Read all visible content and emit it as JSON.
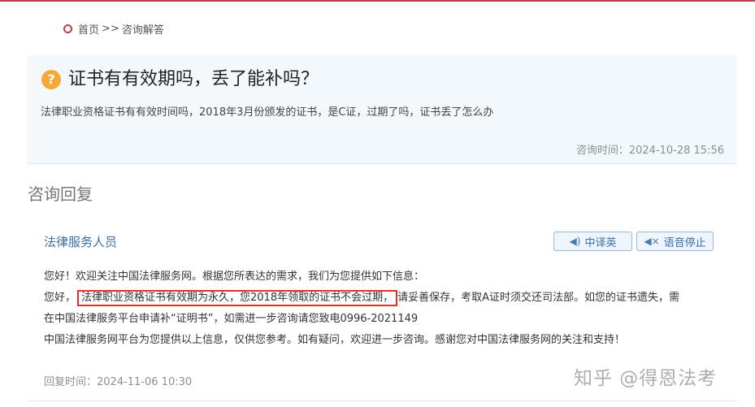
{
  "breadcrumb": {
    "home": "首页",
    "separator": ">>",
    "current": "咨询解答"
  },
  "question": {
    "icon": "?",
    "title": "证书有有效期吗，丢了能补吗？",
    "description": "法律职业资格证书有有效时间吗，2018年3月份颁发的证书，是C证，过期了吗，证书丢了怎么办",
    "time": "咨询时间：2024-10-28 15:56"
  },
  "section_title": "咨询回复",
  "reply": {
    "author": "法律服务人员",
    "translate_button": "中译英",
    "stop_button": "语音停止",
    "line1": "您好！欢迎关注中国法律服务网。根据您所表达的需求，我们为您提供如下信息：",
    "line2_prefix": "您好，",
    "line2_highlight": "法律职业资格证书有效期为永久，您2018年领取的证书不会过期，",
    "line2_suffix": "请妥善保存，考取A证时须交还司法部。如您的证书遗失，需",
    "line3": "在中国法律服务平台申请补“证明书”，如需进一步咨询请您致电0996-2021149",
    "line4": "中国法律服务网平台为您提供以上信息，仅供您参考。如有疑问，欢迎进一步咨询。感谢您对中国法律服务网的关注和支持！",
    "time": "回复时间：2024-11-06 10:30"
  },
  "watermark": "知乎 @得恩法考",
  "colors": {
    "accent_red": "#b8404a",
    "highlight_border": "#e0322b",
    "link_blue": "#3d6fa8",
    "question_bg": "#f3f8fd",
    "question_icon": "#f4a937"
  },
  "icons": {
    "breadcrumb": "circle-dot-icon",
    "question": "question-mark-icon",
    "translate": "speaker-icon",
    "stop": "speaker-mute-icon"
  }
}
